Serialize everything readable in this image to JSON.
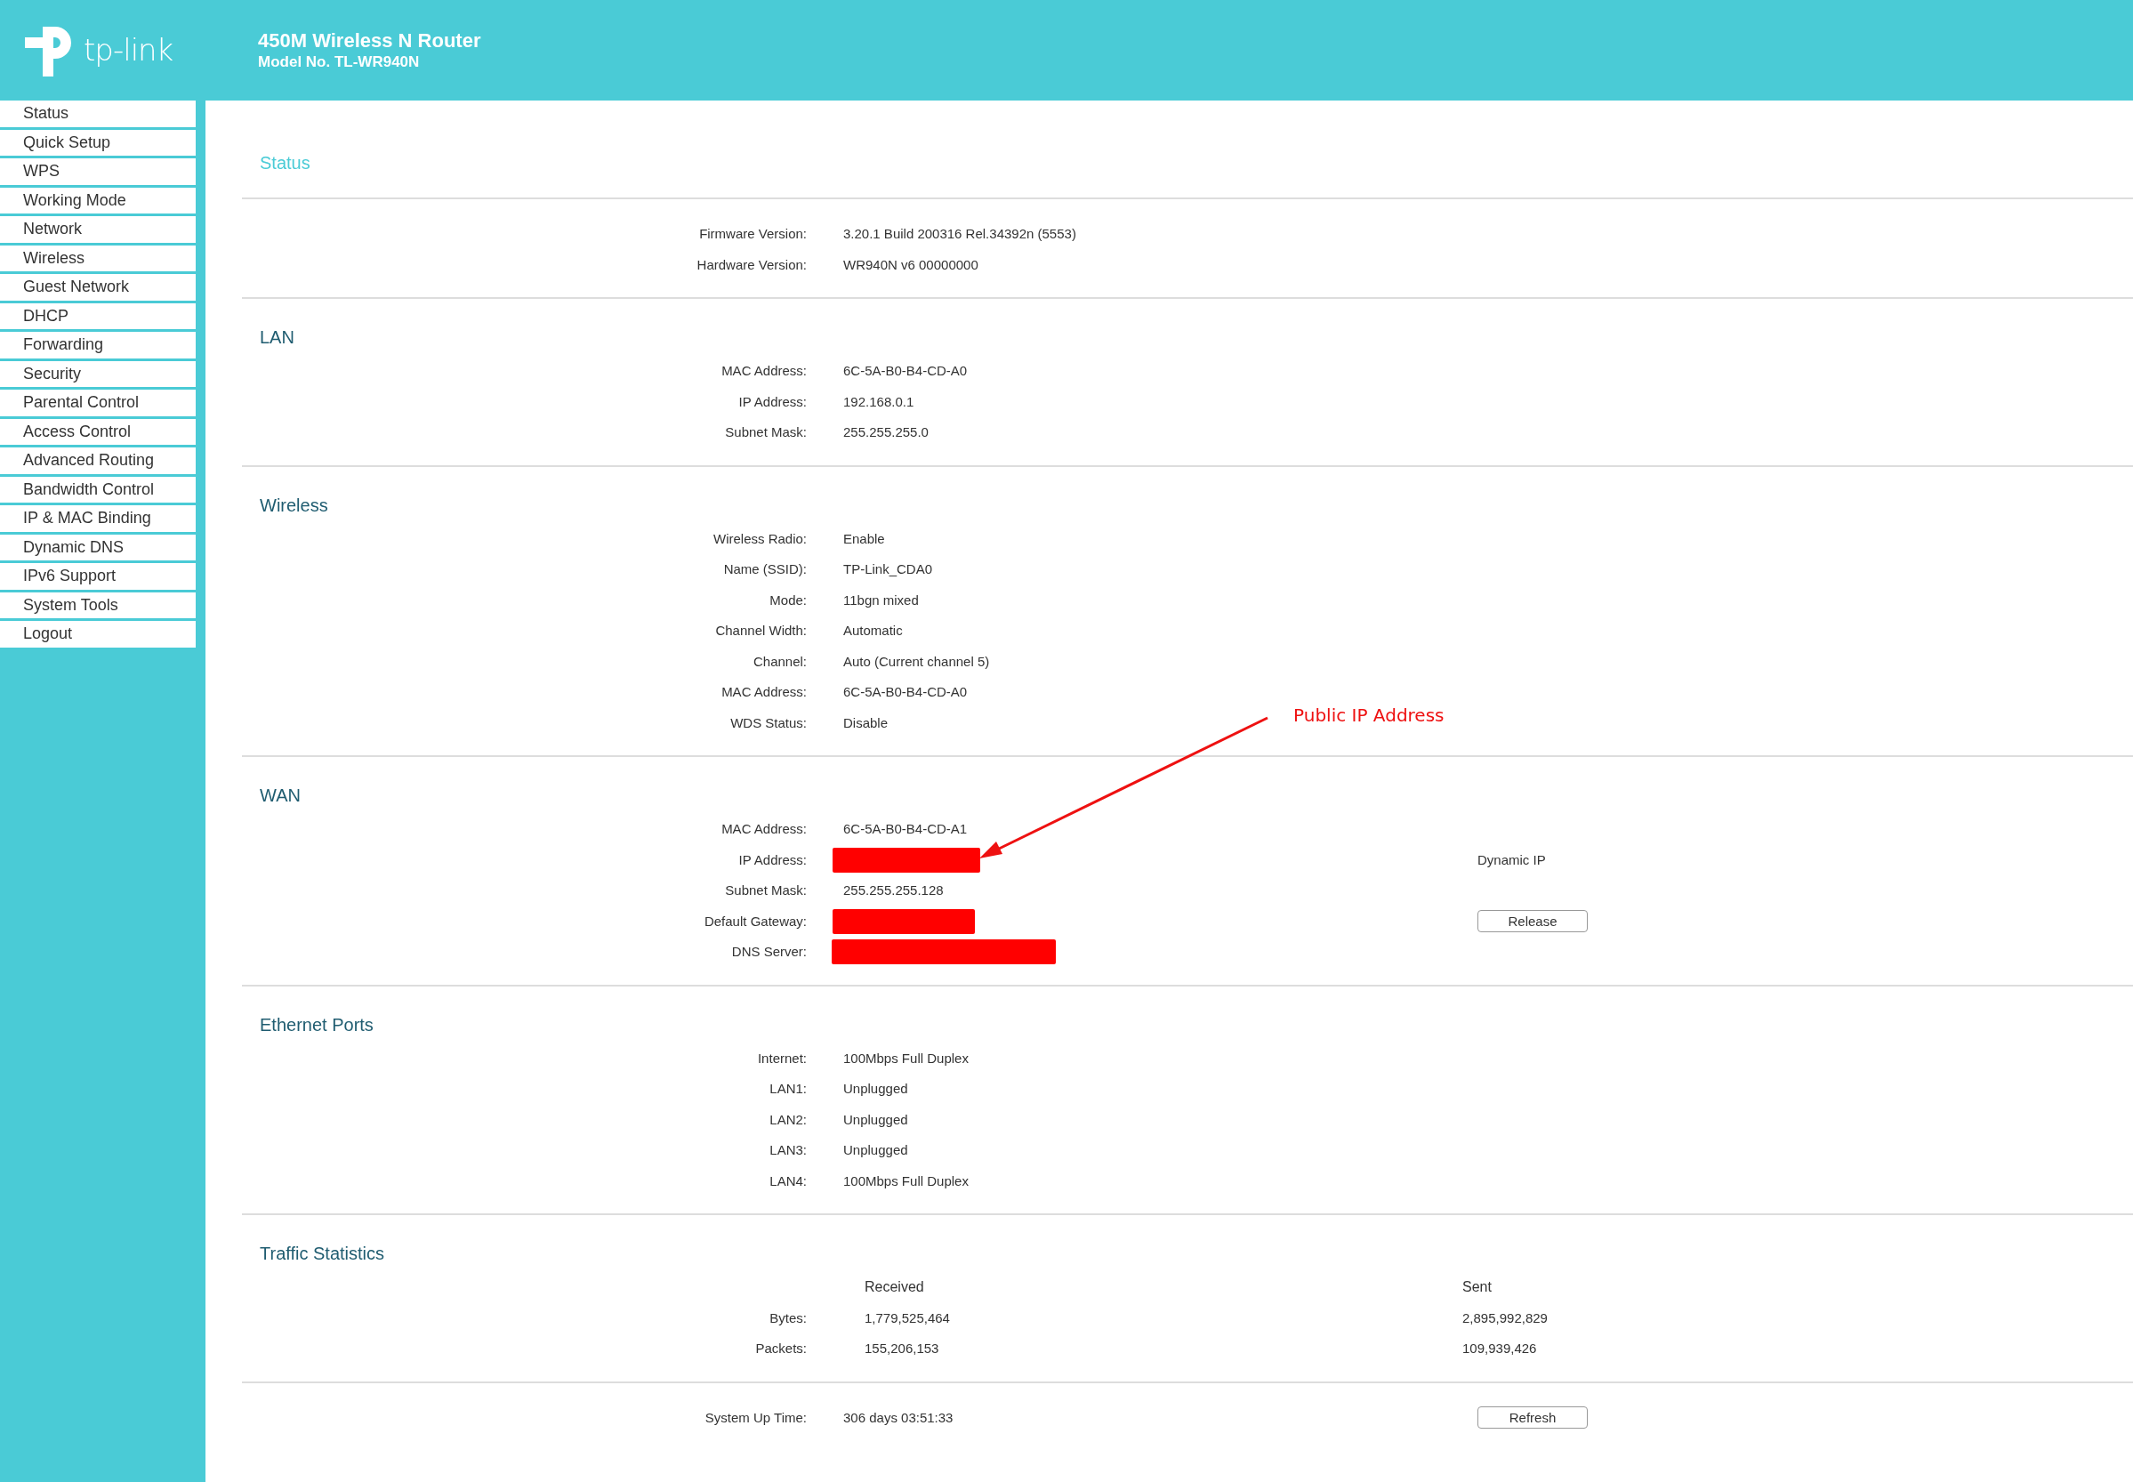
{
  "header": {
    "logo_text": "tp-link",
    "title": "450M Wireless N Router",
    "model": "Model No. TL-WR940N"
  },
  "sidebar": {
    "items": [
      {
        "label": "Status"
      },
      {
        "label": "Quick Setup"
      },
      {
        "label": "WPS"
      },
      {
        "label": "Working Mode"
      },
      {
        "label": "Network"
      },
      {
        "label": "Wireless"
      },
      {
        "label": "Guest Network"
      },
      {
        "label": "DHCP"
      },
      {
        "label": "Forwarding"
      },
      {
        "label": "Security"
      },
      {
        "label": "Parental Control"
      },
      {
        "label": "Access Control"
      },
      {
        "label": "Advanced Routing"
      },
      {
        "label": "Bandwidth Control"
      },
      {
        "label": "IP & MAC Binding"
      },
      {
        "label": "Dynamic DNS"
      },
      {
        "label": "IPv6 Support"
      },
      {
        "label": "System Tools"
      },
      {
        "label": "Logout"
      }
    ]
  },
  "page_title": "Status",
  "sections": [
    {
      "kind": "info",
      "rows": [
        {
          "label": "Firmware Version:",
          "value": "3.20.1 Build 200316 Rel.34392n (5553)"
        },
        {
          "label": "Hardware Version:",
          "value": "WR940N v6 00000000"
        }
      ]
    },
    {
      "kind": "info",
      "title": "LAN",
      "rows": [
        {
          "label": "MAC Address:",
          "value": "6C-5A-B0-B4-CD-A0"
        },
        {
          "label": "IP Address:",
          "value": "192.168.0.1"
        },
        {
          "label": "Subnet Mask:",
          "value": "255.255.255.0"
        }
      ]
    },
    {
      "kind": "info",
      "title": "Wireless",
      "rows": [
        {
          "label": "Wireless Radio:",
          "value": "Enable"
        },
        {
          "label": "Name (SSID):",
          "value": "TP-Link_CDA0"
        },
        {
          "label": "Mode:",
          "value": "11bgn mixed"
        },
        {
          "label": "Channel Width:",
          "value": "Automatic"
        },
        {
          "label": "Channel:",
          "value": "Auto (Current channel 5)"
        },
        {
          "label": "MAC Address:",
          "value": "6C-5A-B0-B4-CD-A0"
        },
        {
          "label": "WDS Status:",
          "value": "Disable"
        }
      ]
    },
    {
      "kind": "info",
      "title": "WAN",
      "rows": [
        {
          "label": "MAC Address:",
          "value": "6C-5A-B0-B4-CD-A1"
        },
        {
          "label": "IP Address:",
          "redacted": true,
          "aside": {
            "kind": "text",
            "text": "Dynamic IP"
          }
        },
        {
          "label": "Subnet Mask:",
          "value": "255.255.255.128"
        },
        {
          "label": "Default Gateway:",
          "redacted": true,
          "aside": {
            "kind": "button",
            "text": "Release"
          }
        },
        {
          "label": "DNS Server:",
          "redacted": true
        }
      ]
    },
    {
      "kind": "info",
      "title": "Ethernet Ports",
      "rows": [
        {
          "label": "Internet:",
          "value": "100Mbps Full Duplex"
        },
        {
          "label": "LAN1:",
          "value": "Unplugged"
        },
        {
          "label": "LAN2:",
          "value": "Unplugged"
        },
        {
          "label": "LAN3:",
          "value": "Unplugged"
        },
        {
          "label": "LAN4:",
          "value": "100Mbps Full Duplex"
        }
      ]
    },
    {
      "kind": "table",
      "title": "Traffic Statistics",
      "columns": [
        "Received",
        "Sent"
      ],
      "rows": [
        {
          "label": "Bytes:",
          "values": [
            "1,779,525,464",
            "2,895,992,829"
          ]
        },
        {
          "label": "Packets:",
          "values": [
            "155,206,153",
            "109,939,426"
          ]
        }
      ]
    },
    {
      "kind": "info",
      "rows": [
        {
          "label": "System Up Time:",
          "value": "306 days 03:51:33",
          "aside": {
            "kind": "button",
            "text": "Refresh"
          }
        }
      ]
    }
  ],
  "annotation": {
    "text": "Public IP Address"
  }
}
